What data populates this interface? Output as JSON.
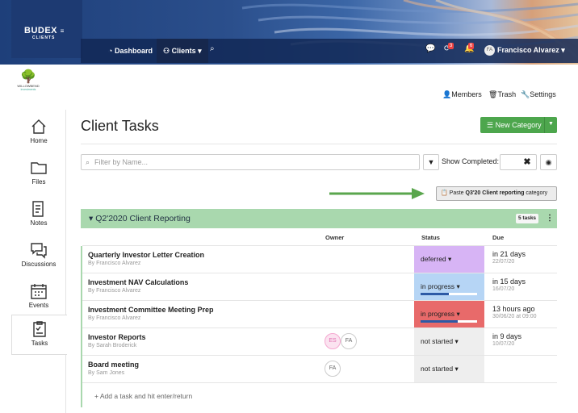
{
  "header": {
    "logo_main": "BUDEX",
    "logo_sub": "CLIENTS",
    "nav": [
      {
        "label": "Dashboard",
        "icon": "dashboard-icon"
      },
      {
        "label": "Clients",
        "icon": "sitemap-icon"
      }
    ],
    "badges": {
      "refresh": "3",
      "bell": "6"
    },
    "user": {
      "initials": "FA",
      "name": "Francisco Alvarez"
    }
  },
  "org": {
    "name": "WILLOWBEND",
    "tagline": "investments"
  },
  "top_links": [
    {
      "label": "Members",
      "icon": "user-icon"
    },
    {
      "label": "Trash",
      "icon": "trash-icon"
    },
    {
      "label": "Settings",
      "icon": "wrench-icon"
    }
  ],
  "sidebar": {
    "items": [
      {
        "label": "Home",
        "icon": "home-icon"
      },
      {
        "label": "Files",
        "icon": "folder-icon"
      },
      {
        "label": "Notes",
        "icon": "notes-icon"
      },
      {
        "label": "Discussions",
        "icon": "discussions-icon"
      },
      {
        "label": "Events",
        "icon": "calendar-icon"
      },
      {
        "label": "Tasks",
        "icon": "tasks-icon",
        "active": true
      }
    ]
  },
  "main": {
    "title": "Client Tasks",
    "new_category": "New Category",
    "filter_placeholder": "Filter by Name...",
    "show_completed": "Show Completed:",
    "paste": {
      "prefix": "Paste",
      "bold": "Q3'20 Client reporting",
      "suffix": "category"
    },
    "category": {
      "title": "Q2'2020 Client Reporting",
      "tasks_count": "5 tasks"
    },
    "columns": {
      "owner": "Owner",
      "status": "Status",
      "due": "Due"
    },
    "tasks": [
      {
        "name": "Quarterly Investor Letter Creation",
        "by": "By Francisco Alvarez",
        "owners": [],
        "status": "deferred",
        "status_color": "#d7b4f5",
        "progress": null,
        "due": "in 21 days",
        "due_date": "22/07/20"
      },
      {
        "name": "Investment NAV Calculations",
        "by": "By Francisco Alvarez",
        "owners": [],
        "status": "in progress",
        "status_color": "#b6d5f5",
        "progress": 0.5,
        "due": "in 15 days",
        "due_date": "16/07/20"
      },
      {
        "name": "Investment Committee Meeting Prep",
        "by": "By Francisco Alvarez",
        "owners": [],
        "status": "in progress",
        "status_color": "#e86a6a",
        "progress": 0.65,
        "due": "13 hours ago",
        "due_date": "30/06/20 at 09:00"
      },
      {
        "name": "Investor Reports",
        "by": "By Sarah Broderick",
        "owners": [
          "ES",
          "FA"
        ],
        "status": "not started",
        "status_color": "#eeeeee",
        "progress": null,
        "due": "in 9 days",
        "due_date": "10/07/20"
      },
      {
        "name": "Board meeting",
        "by": "By Sam Jones",
        "owners": [
          "FA"
        ],
        "status": "not started",
        "status_color": "#eeeeee",
        "progress": null,
        "due": "",
        "due_date": ""
      }
    ],
    "add_task": "+ Add a task and hit enter/return"
  }
}
